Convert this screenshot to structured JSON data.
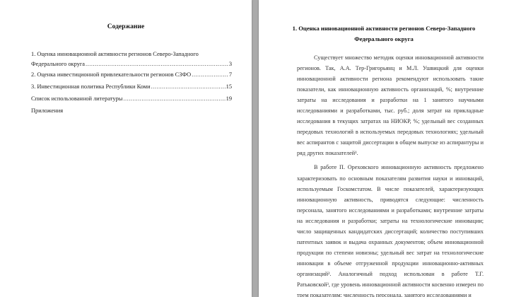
{
  "left_page": {
    "title": "Содержание",
    "toc": [
      {
        "lines": [
          "1. Оценка инновационной  активности регионов Северо-Западного",
          "Федерального округа"
        ],
        "page": "3"
      },
      {
        "lines": [
          "2. Оценка инвестиционной привлекательности регионов СЗФО"
        ],
        "page": "7"
      },
      {
        "lines": [
          "3. Инвестиционная политика Республики Коми"
        ],
        "page": "15"
      },
      {
        "lines": [
          "Список использованной литературы"
        ],
        "page": "19"
      },
      {
        "lines": [
          "Приложения"
        ],
        "page": ""
      }
    ]
  },
  "right_page": {
    "section_title_line1": "1. Оценка инновационной активности регионов Северо-Западного",
    "section_title_line2": "Федерального округа",
    "paragraph1": [
      "Существует множество методик оценки инновационной активности",
      "регионов. Так, А.А. Тер-Григорьянц и М.Л. Ушвицкий для оценки",
      "инновационной активности региона рекомендуют использовать такие",
      "показатели, как инновационную активность организаций, %; внутренние",
      "затраты на исследования и разработки на 1 занятого научными",
      "исследованиями и разработками, тыс. руб.; доля затрат на прикладные",
      "исследования в текущих затратах на НИОКР, %; удельный вес созданных",
      "передовых технологий в используемых передовых технологиях; удельный",
      "вес аспирантов с защитой диссертации в общем выпуске из аспирантуры и",
      "ряд других показателей¹."
    ],
    "paragraph2": [
      "В работе П. Ореховского инновационную активность предложено",
      "характеризовать по основным показателям развития науки и инноваций,",
      "используемым Госкомстатом. В числе показателей, характеризующих",
      "инновационную активность, приводятся следующие: численность",
      "персонала, занятого исследованиями и разработками; внутренние затраты",
      "на исследования и разработки; затраты на технологические инновации;",
      "число защищенных кандидатских диссертаций; количество поступивших",
      "патентных заявок и выдача охранных документов; объем инновационной",
      "продукции по степени новизны; удельный вес затрат на технологические",
      "инновации в объеме отгруженной продукции инновационно-активных",
      "организаций². Аналогичный подход использован в работе Т.Г.",
      "Ратьковской³, где уровень инновационной активности косвенно измерен по",
      "трем показателям: численность персонала, занятого исследованиями и"
    ]
  }
}
